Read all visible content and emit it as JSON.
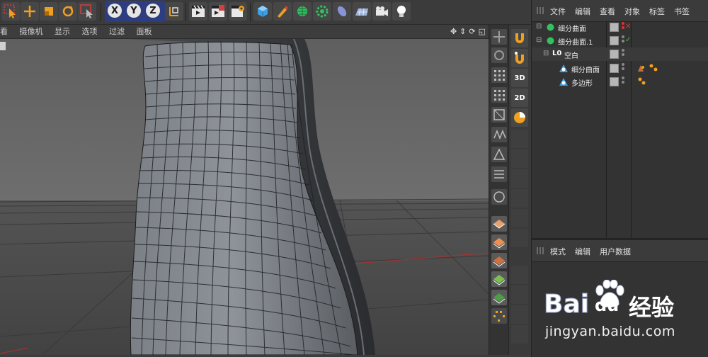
{
  "toolbar": {
    "axis_x": "X",
    "axis_y": "Y",
    "axis_z": "Z",
    "icons": [
      "select-arrow-icon",
      "move-icon",
      "scale-icon",
      "rotate-icon",
      "live-select-icon",
      "coordinate-system-icon",
      "render-view-icon",
      "render-picture-viewer-icon",
      "render-settings-icon",
      "cube-icon",
      "pen-icon",
      "subdivision-surface-icon",
      "array-icon",
      "deformer-icon",
      "floor-icon",
      "camera-icon",
      "light-icon"
    ]
  },
  "viewport_menu": {
    "items": [
      "看",
      "摄像机",
      "显示",
      "选项",
      "过滤",
      "面板"
    ],
    "controls": [
      "✥",
      "⇕",
      "⟳",
      "◱"
    ]
  },
  "object_manager": {
    "menu": [
      "文件",
      "编辑",
      "查看",
      "对象",
      "标签",
      "书签"
    ],
    "objects": [
      {
        "name": "细分曲面",
        "status": "✕",
        "status_color": "#e03030",
        "expander": "⊟"
      },
      {
        "name": "细分曲面.1",
        "status": "✓",
        "status_color": "#3ec43e",
        "expander": "⊟"
      },
      {
        "name": "空白",
        "prefix": "L0",
        "expander": "⊟"
      },
      {
        "name": "细分曲面"
      },
      {
        "name": "多边形"
      }
    ]
  },
  "attribute_manager": {
    "menu": [
      "模式",
      "编辑",
      "用户数据"
    ]
  },
  "watermark": {
    "brand_latin_1": "Bai",
    "brand_latin_2": "du",
    "brand_cn": "经验",
    "url": "jingyan.baidu.com"
  },
  "colors": {
    "accent_orange": "#f0a020",
    "selection_red": "#e03030",
    "ok_green": "#3ec43e",
    "brand_blue": "#2932e1"
  }
}
